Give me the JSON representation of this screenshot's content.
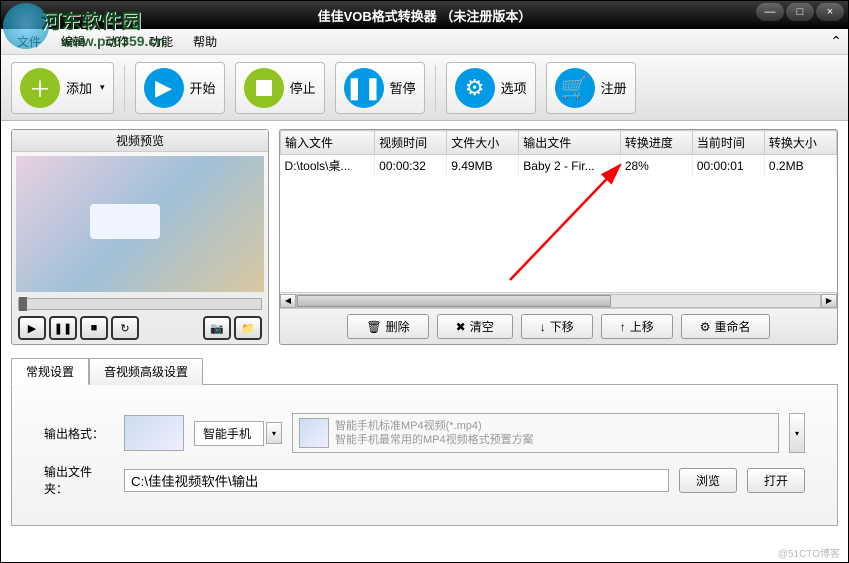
{
  "watermark": {
    "text": "河东软件园",
    "url": "www.pc0359.cn"
  },
  "footer_watermark": "@51CTO博客",
  "titlebar": {
    "title": "佳佳VOB格式转换器   （未注册版本）"
  },
  "win": {
    "min": "—",
    "max": "□",
    "close": "×"
  },
  "menu": {
    "file": "文件",
    "edit": "编辑",
    "action": "动作",
    "function": "功能",
    "help": "帮助"
  },
  "toolbar": {
    "add": "添加",
    "start": "开始",
    "stop": "停止",
    "pause": "暂停",
    "options": "选项",
    "register": "注册"
  },
  "preview": {
    "title": "视频预览"
  },
  "table": {
    "headers": {
      "input": "输入文件",
      "vtime": "视频时间",
      "fsize": "文件大小",
      "output": "输出文件",
      "progress": "转换进度",
      "curtime": "当前时间",
      "convsize": "转换大小"
    },
    "row1": {
      "input": "D:\\tools\\桌...",
      "vtime": "00:00:32",
      "fsize": "9.49MB",
      "output": "Baby 2 - Fir...",
      "progress": "28%",
      "curtime": "00:00:01",
      "convsize": "0.2MB"
    }
  },
  "listbtns": {
    "delete": "删除",
    "clear": "清空",
    "movedown": "下移",
    "moveup": "上移",
    "rename": "重命名"
  },
  "tabs": {
    "general": "常规设置",
    "av": "音视频高级设置"
  },
  "form": {
    "fmt_label": "输出格式：",
    "phone_combo": "智能手机",
    "preset_line1": "智能手机标准MP4视频(*.mp4)",
    "preset_line2": "智能手机最常用的MP4视频格式预置方案",
    "dir_label": "输出文件夹：",
    "dir_value": "C:\\佳佳视频软件\\输出",
    "browse": "浏览",
    "open": "打开"
  },
  "icons": {
    "trash": "🗑",
    "x": "✖",
    "down": "↓",
    "up": "↑",
    "gear": "⚙",
    "cart": "🛒",
    "folder": "📁",
    "camera": "📷",
    "loop": "↻",
    "play": "▶",
    "pause": "❚❚",
    "stop": "■",
    "tri": "▾"
  }
}
